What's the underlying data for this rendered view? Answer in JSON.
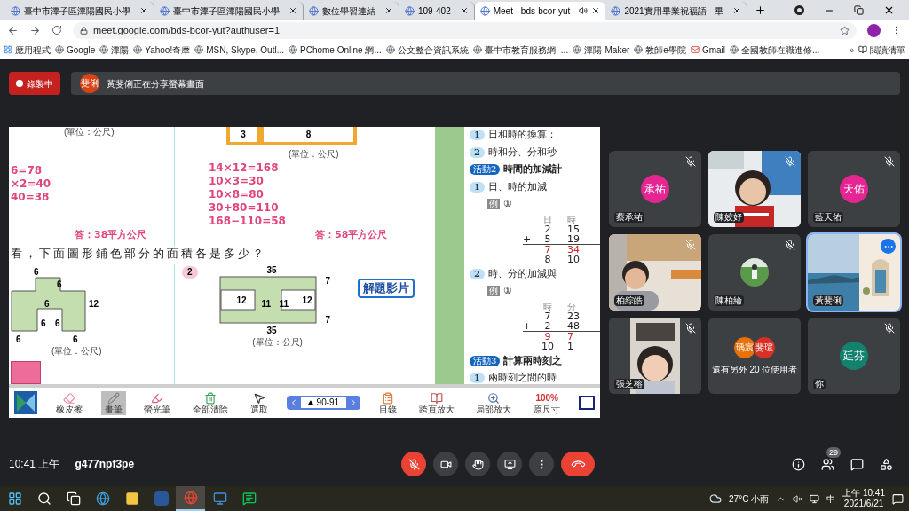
{
  "browser": {
    "tabs": [
      {
        "title": "臺中市潭子區潭陽國民小學",
        "selected": false
      },
      {
        "title": "臺中市潭子區潭陽國民小學",
        "selected": false
      },
      {
        "title": "數位學習連結",
        "selected": false
      },
      {
        "title": "109-402",
        "selected": false
      },
      {
        "title": "Meet - bds-bcor-yut",
        "selected": true,
        "audio": true
      },
      {
        "title": "2021實用畢業祝福語 - 畢",
        "selected": false
      }
    ],
    "address": "meet.google.com/bds-bcor-yut?authuser=1",
    "bookmarks": [
      "應用程式",
      "Google",
      "潭陽",
      "Yahoo!奇摩",
      "MSN, Skype, Outl...",
      "PChome Online 網...",
      "公文整合資訊系統",
      "臺中市教育服務網 -...",
      "潭陽-Maker",
      "教師e學院",
      "Gmail",
      "全國教師在職進修..."
    ],
    "more_bookmarks": "»",
    "reading_list": "閱讀清單"
  },
  "meet": {
    "recording": "錄製中",
    "share_banner": {
      "avatar_text": "斐俐",
      "color": "#d84315",
      "text": "黃斐俐正在分享螢幕畫面"
    },
    "shared_screen": {
      "left_top": {
        "unit": "(單位：公尺)",
        "calc": [
          "6=78",
          "×2=40",
          "40=38"
        ],
        "answer": "答：38平方公尺"
      },
      "right_top": {
        "labels": [
          "3",
          "8"
        ],
        "unit": "(單位：公尺)",
        "calc": [
          "14×12=168",
          "10×3=30",
          "10×8=80",
          "30+80=110",
          "168−110=58"
        ],
        "answer": "答：58平方公尺"
      },
      "question": "看，下面圖形鋪色部分的面積各是多少？",
      "left_bottom": {
        "labels": [
          "6",
          "6",
          "12",
          "6",
          "6",
          "6",
          "6",
          "6"
        ],
        "unit": "(單位：公尺)"
      },
      "right_bottom": {
        "number": "2",
        "labels": [
          "35",
          "7",
          "12",
          "11",
          "11",
          "12",
          "7",
          "35"
        ],
        "unit": "(單位：公尺)",
        "video_button": "解題影片"
      },
      "right_page": [
        {
          "kind": "item",
          "num": "1",
          "text": "日和時的換算："
        },
        {
          "kind": "item",
          "num": "2",
          "text": "時和分、分和秒"
        },
        {
          "kind": "activity",
          "num": "活動2",
          "text": "時間的加減計"
        },
        {
          "kind": "item",
          "num": "1",
          "text": "日、時的加減"
        },
        {
          "kind": "example",
          "num": "例",
          "text": "①"
        },
        {
          "kind": "sum",
          "heads": [
            "日",
            "時"
          ],
          "rows": [
            [
              "",
              "2",
              "15"
            ],
            [
              "+",
              "5",
              "19"
            ],
            [
              "",
              "7",
              "34"
            ],
            [
              "",
              "8",
              "10"
            ]
          ]
        },
        {
          "kind": "item",
          "num": "2",
          "text": "時、分的加減與"
        },
        {
          "kind": "example",
          "num": "例",
          "text": "①"
        },
        {
          "kind": "sum",
          "heads": [
            "時",
            "分"
          ],
          "rows": [
            [
              "",
              "7",
              "23"
            ],
            [
              "+",
              "2",
              "48"
            ],
            [
              "",
              "9",
              "7"
            ],
            [
              "",
              "10",
              "1"
            ]
          ]
        },
        {
          "kind": "activity",
          "num": "活動3",
          "text": "計算兩時刻之"
        },
        {
          "kind": "item",
          "num": "1",
          "text": "兩時刻之間的時"
        }
      ],
      "toolbar": [
        {
          "kind": "logo"
        },
        {
          "kind": "tool",
          "label": "橡皮擦",
          "selected": false
        },
        {
          "kind": "tool",
          "label": "畫筆",
          "selected": true
        },
        {
          "kind": "tool",
          "label": "螢光筆",
          "selected": false
        },
        {
          "kind": "tool",
          "label": "全部清除",
          "selected": false
        },
        {
          "kind": "tool",
          "label": "選取",
          "selected": false
        },
        {
          "kind": "pager",
          "text": "90-91"
        },
        {
          "kind": "tool",
          "label": "目錄",
          "selected": false
        },
        {
          "kind": "tool",
          "label": "跨頁放大",
          "selected": false
        },
        {
          "kind": "tool",
          "label": "局部放大",
          "selected": false
        },
        {
          "kind": "text_tool",
          "text": "100%",
          "label": "原尺寸",
          "selected": false
        },
        {
          "kind": "square"
        }
      ]
    },
    "participants": [
      {
        "kind": "avatar",
        "name": "蔡承祐",
        "avatar_text": "承祐",
        "color": "#e52592",
        "muted": true,
        "highlighted": false
      },
      {
        "kind": "video",
        "name": "陳姣好",
        "muted": true,
        "highlighted": false
      },
      {
        "kind": "avatar",
        "name": "藍天佑",
        "avatar_text": "天佑",
        "color": "#e52592",
        "muted": true,
        "highlighted": false
      },
      {
        "kind": "video",
        "name": "柏綜皓",
        "muted": true,
        "highlighted": false
      },
      {
        "name": "陳柏綸",
        "muted": true,
        "highlighted": false
      },
      {
        "kind": "scenery",
        "name": "黃斐俐",
        "muted": false,
        "highlighted": true
      },
      {
        "kind": "video",
        "name": "張芝榕",
        "muted": true,
        "highlighted": false
      },
      {
        "kind": "others",
        "name": "還有另外 20 位使用者",
        "avatars": [
          {
            "text": "瑀宸",
            "color": "#e8710a"
          },
          {
            "text": "斐瑄",
            "color": "#d93025"
          }
        ],
        "muted": false,
        "highlighted": false
      },
      {
        "kind": "avatar",
        "name": "你",
        "avatar_text": "廷芬",
        "color": "#12826f",
        "muted": true,
        "highlighted": false
      }
    ],
    "time": "10:41 上午",
    "code": "g477npf3pe",
    "people_count": "29"
  },
  "taskbar": {
    "weather": "27°C 小雨",
    "ime": "中",
    "time": "上午 10:41",
    "date": "2021/6/21"
  }
}
